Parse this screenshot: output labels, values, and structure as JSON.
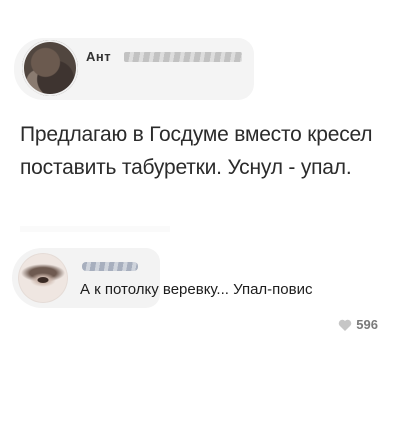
{
  "post": {
    "author_visible": "Ант",
    "text": "Предлагаю в Госдуме вместо кресел поставить табуретки. Уснул - упал."
  },
  "comment": {
    "text": "А к потолку веревку... Упал-повис",
    "likes": "596"
  },
  "icons": {
    "like": "heart-icon"
  }
}
